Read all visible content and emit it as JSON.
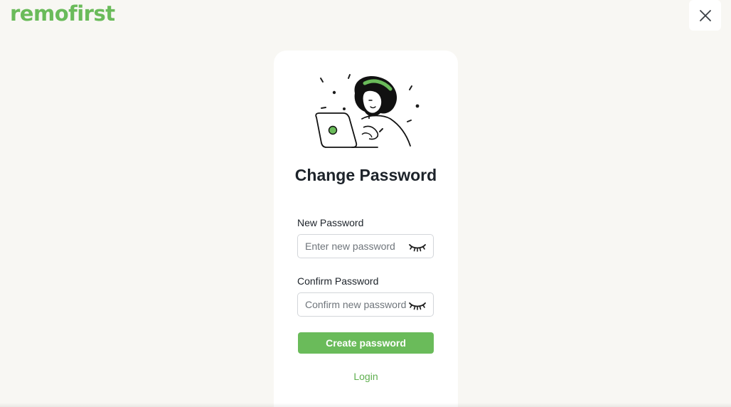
{
  "brand": {
    "logo_text": "remofirst",
    "accent_color": "#6abb5a"
  },
  "header": {
    "close_icon": "close-icon"
  },
  "card": {
    "illustration": "person-with-laptop-illustration",
    "title": "Change Password",
    "new_password": {
      "label": "New Password",
      "placeholder": "Enter new password",
      "value": "",
      "toggle_icon": "eye-closed-icon"
    },
    "confirm_password": {
      "label": "Confirm Password",
      "placeholder": "Confirm new password",
      "value": "",
      "toggle_icon": "eye-closed-icon"
    },
    "submit_label": "Create password",
    "login_label": "Login"
  }
}
